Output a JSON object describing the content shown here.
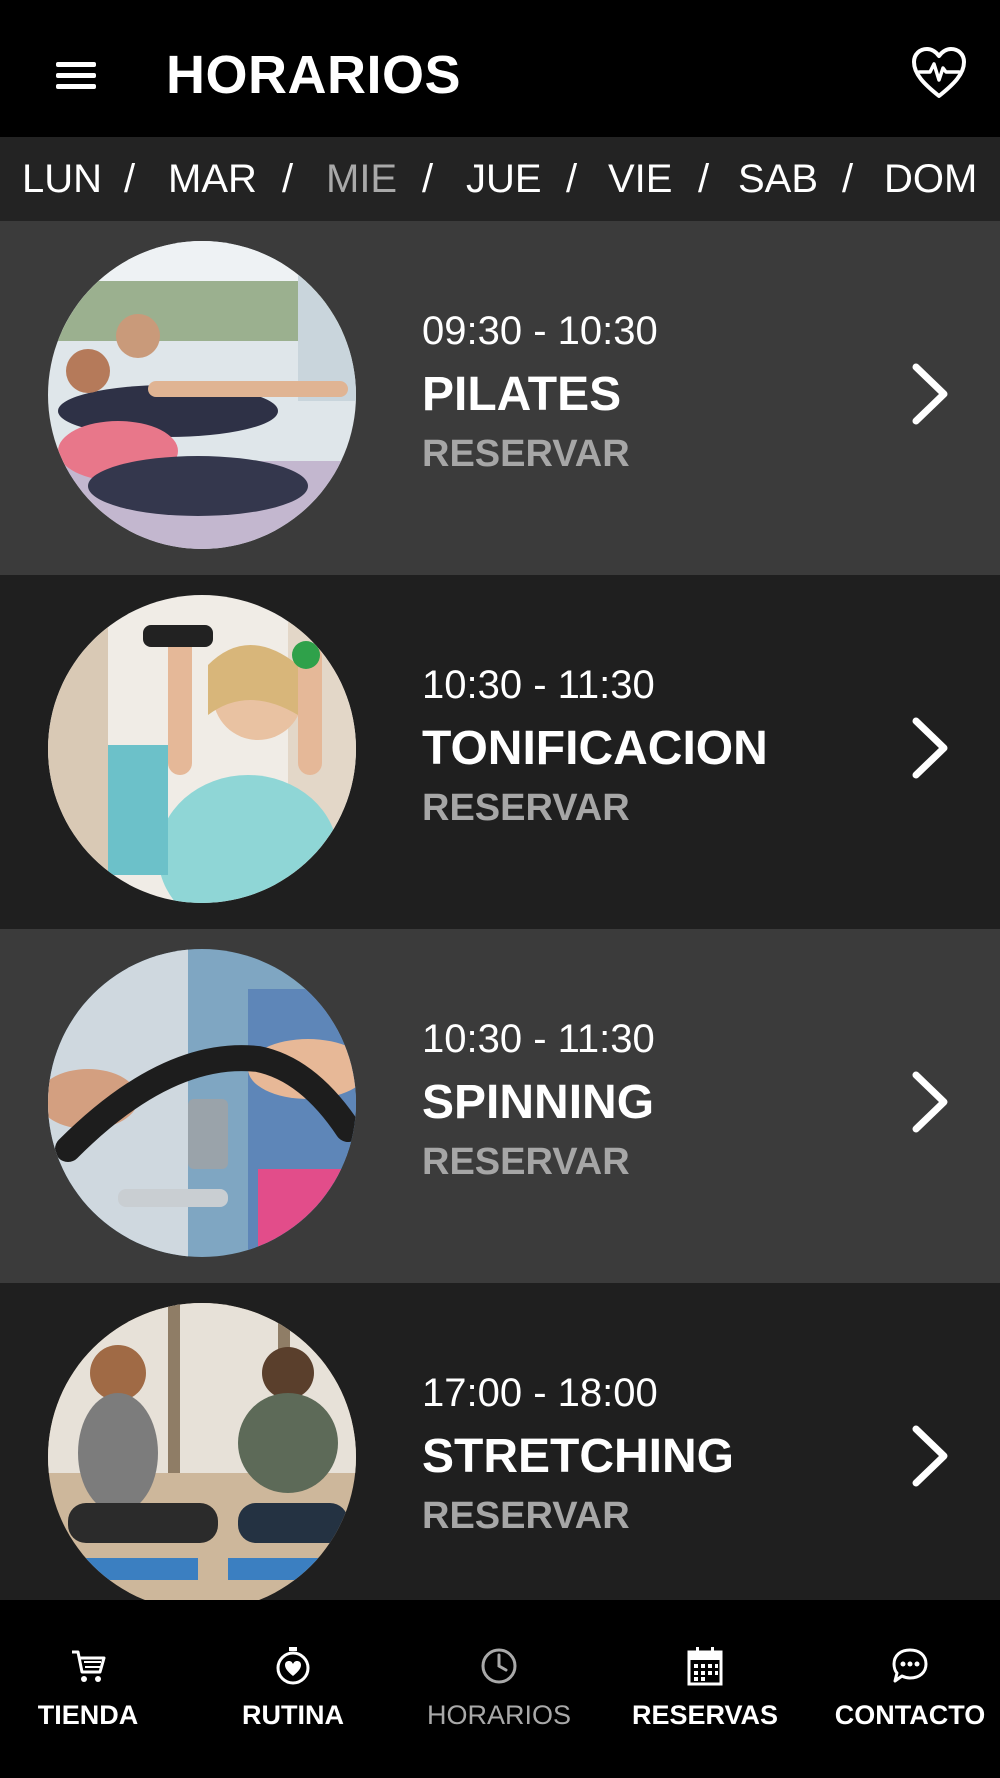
{
  "header": {
    "title": "HORARIOS",
    "menu_icon": "hamburger-menu-icon",
    "right_icon": "heart-pulse-icon"
  },
  "days": {
    "items": [
      "LUN",
      "MAR",
      "MIE",
      "JUE",
      "VIE",
      "SAB",
      "DOM"
    ],
    "separator": "/",
    "active": "MIE"
  },
  "classes": [
    {
      "time": "09:30 - 10:30",
      "name": "PILATES",
      "action": "RESERVAR"
    },
    {
      "time": "10:30 - 11:30",
      "name": "TONIFICACION",
      "action": "RESERVAR"
    },
    {
      "time": "10:30 - 11:30",
      "name": "SPINNING",
      "action": "RESERVAR"
    },
    {
      "time": "17:00 - 18:00",
      "name": "STRETCHING",
      "action": "RESERVAR"
    }
  ],
  "bottom_nav": [
    {
      "label": "TIENDA",
      "icon": "cart-icon"
    },
    {
      "label": "RUTINA",
      "icon": "stopwatch-heart-icon"
    },
    {
      "label": "HORARIOS",
      "icon": "clock-icon",
      "active": true
    },
    {
      "label": "RESERVAS",
      "icon": "calendar-icon"
    },
    {
      "label": "CONTACTO",
      "icon": "chat-bubble-icon"
    }
  ],
  "colors": {
    "background": "#000000",
    "row_light": "#3b3b3b",
    "row_dark": "#1f1f1f",
    "daybar": "#232323",
    "inactive_text": "#a6a6a6"
  }
}
